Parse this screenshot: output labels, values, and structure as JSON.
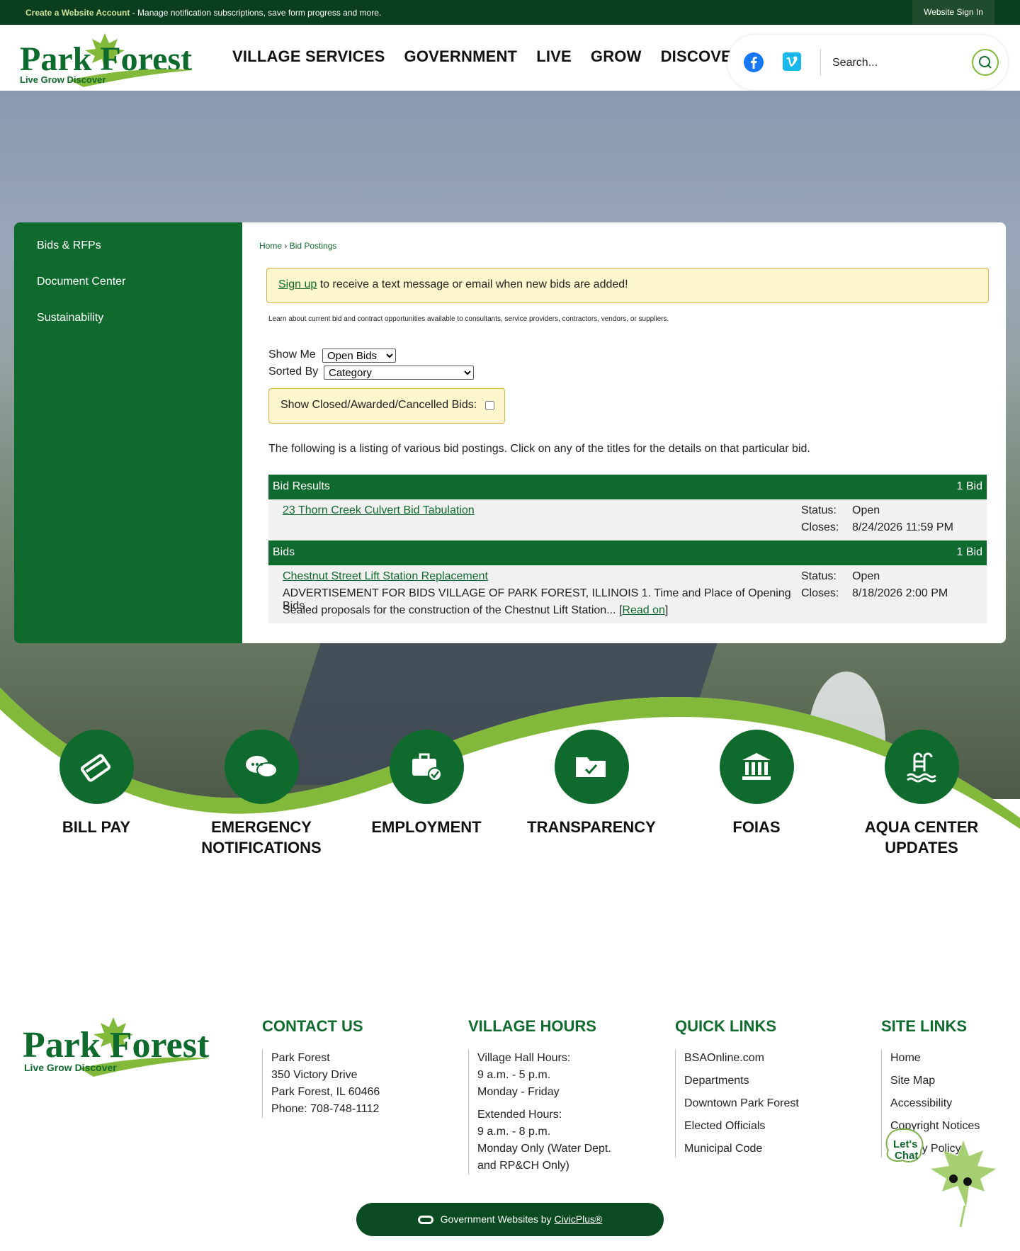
{
  "topbar": {
    "create_link": "Create a Website Account",
    "message": " - Manage notification subscriptions, save form progress and more.",
    "signin": "Website Sign In"
  },
  "header": {
    "logo_text": "Park Forest",
    "logo_tagline": "Live  Grow  Discover",
    "nav": [
      "VILLAGE SERVICES",
      "GOVERNMENT",
      "LIVE",
      "GROW",
      "DISCOVER"
    ],
    "search_placeholder": "Search..."
  },
  "sidebar": {
    "items": [
      "Bids & RFPs",
      "Document Center",
      "Sustainability"
    ]
  },
  "breadcrumb": {
    "home": "Home",
    "sep": " › ",
    "current": "Bid Postings"
  },
  "notice": {
    "link": "Sign up",
    "text": " to receive a text message or email when new bids are added!"
  },
  "intro": "Learn about current bid and contract opportunities available to consultants, service providers, contractors, vendors, or suppliers.",
  "filters": {
    "show_me_label": "Show Me",
    "show_me_value": "Open Bids",
    "sorted_by_label": "Sorted By",
    "sorted_by_value": "Category",
    "closed_label": "Show Closed/Awarded/Cancelled Bids:"
  },
  "listing_desc": "The following is a listing of various bid postings. Click on any of the titles for the details on that particular bid.",
  "categories": [
    {
      "name": "Bid Results",
      "count": "1 Bid",
      "bid": {
        "title": "23 Thorn Creek Culvert Bid Tabulation",
        "status_label": "Status:",
        "status": "Open",
        "closes_label": "Closes:",
        "closes": "8/24/2026 11:59 PM"
      }
    },
    {
      "name": "Bids",
      "count": "1 Bid",
      "bid": {
        "title": "Chestnut Street Lift Station Replacement",
        "desc1": "ADVERTISEMENT FOR BIDS VILLAGE OF PARK FOREST, ILLINOIS 1. Time and Place of Opening Bids .",
        "desc2": "Sealed proposals for the construction of the Chestnut Lift Station... ",
        "read_on": "Read on",
        "status_label": "Status:",
        "status": "Open",
        "closes_label": "Closes:",
        "closes": "8/18/2026 2:00 PM"
      }
    }
  ],
  "quick_links": [
    {
      "label": "BILL PAY",
      "icon": "credit-card-icon"
    },
    {
      "label": "EMERGENCY NOTIFICATIONS",
      "icon": "chat-bubbles-icon"
    },
    {
      "label": "EMPLOYMENT",
      "icon": "briefcase-icon"
    },
    {
      "label": "TRANSPARENCY",
      "icon": "folder-check-icon"
    },
    {
      "label": "FOIAS",
      "icon": "government-building-icon"
    },
    {
      "label": "AQUA CENTER UPDATES",
      "icon": "pool-ladder-icon"
    }
  ],
  "footer": {
    "contact": {
      "heading": "CONTACT US",
      "lines": [
        "Park Forest",
        "350 Victory Drive",
        "Park Forest, IL 60466",
        "Phone: 708-748-1112"
      ]
    },
    "hours": {
      "heading": "VILLAGE HOURS",
      "block1": [
        "Village Hall Hours:",
        "9 a.m. - 5 p.m.",
        "Monday - Friday"
      ],
      "block2": [
        "Extended Hours:",
        "9 a.m. - 8 p.m.",
        "Monday Only (Water Dept.",
        "and RP&CH Only)"
      ]
    },
    "quick": {
      "heading": "QUICK LINKS",
      "links": [
        "BSAOnline.com",
        "Departments",
        "Downtown Park Forest",
        "Elected Officials",
        "Municipal Code"
      ]
    },
    "site": {
      "heading": "SITE LINKS",
      "links": [
        "Home",
        "Site Map",
        "Accessibility",
        "Copyright Notices",
        "Privacy Policy"
      ]
    },
    "civic_prefix": "Government Websites by ",
    "civic_link": "CivicPlus®"
  },
  "chat": {
    "text1": "Let's",
    "text2": "Chat"
  },
  "colors": {
    "primary_green": "#0f6a2d",
    "lime": "#82b93a",
    "dark_bar": "#0b3d1f",
    "notice_bg": "#fbf6cb"
  }
}
